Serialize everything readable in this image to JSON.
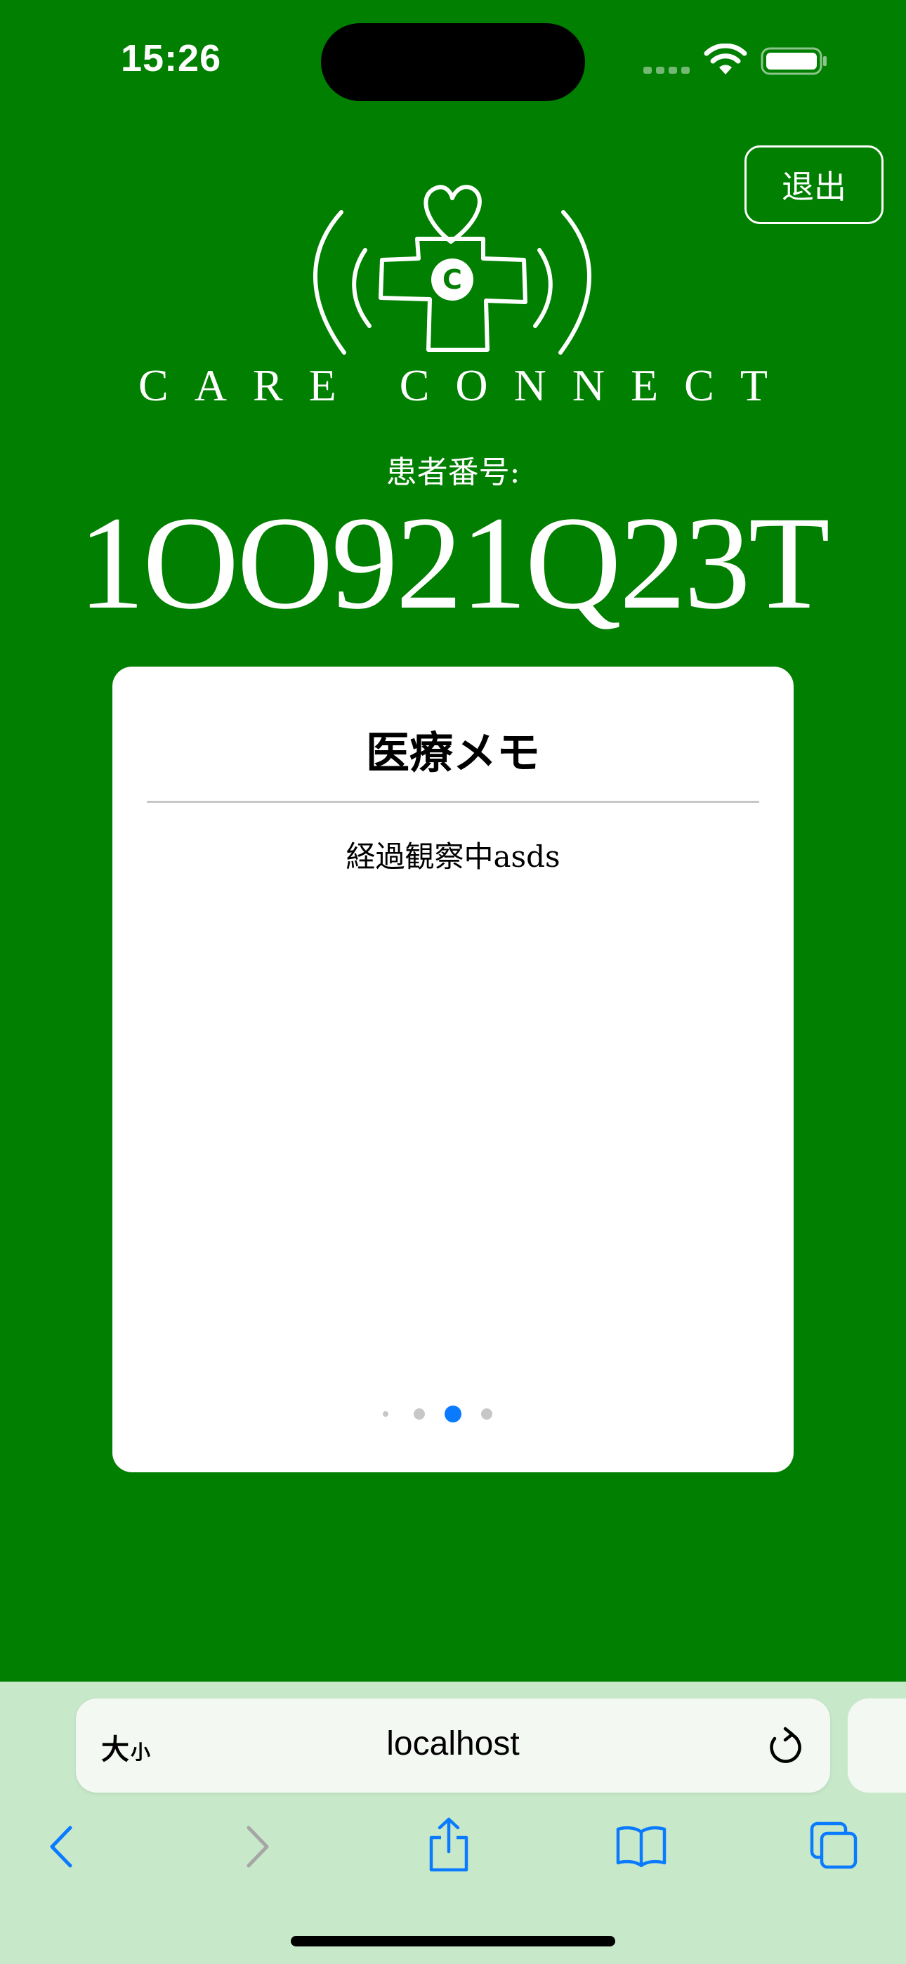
{
  "status_bar": {
    "time": "15:26"
  },
  "header": {
    "logout_label": "退出",
    "brand_name": "CARE CONNECT",
    "logo_letter": "C",
    "patient_label": "患者番号:",
    "patient_number": "1OO921Q23T"
  },
  "memo_card": {
    "title": "医療メモ",
    "text": "経過観察中asds",
    "pagination": {
      "count": 4,
      "active_index": 2
    }
  },
  "browser": {
    "text_size_large": "大",
    "text_size_small": "小",
    "url": "localhost"
  },
  "colors": {
    "background": "#007f00",
    "browser_chrome": "#c7e9c9",
    "accent": "#0a7aff"
  }
}
